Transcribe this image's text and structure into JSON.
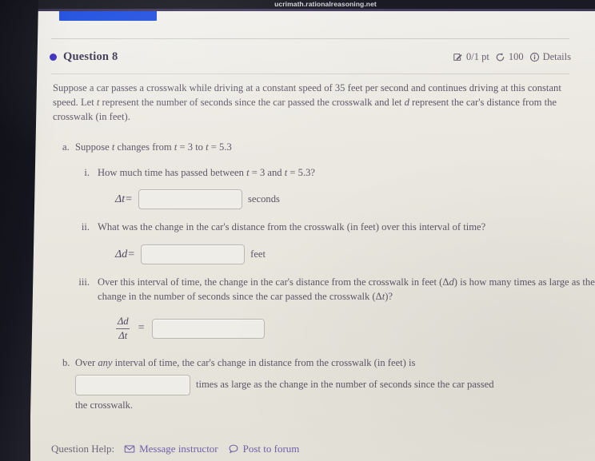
{
  "browser": {
    "url": "ucrimath.rationalreasoning.net"
  },
  "question_header": {
    "title": "Question 8",
    "points": "0/1 pt",
    "attempts": "100",
    "details_label": "Details",
    "bullet_color": "#3a2ec0",
    "points_icon": "checkbox-pencil-icon",
    "attempts_icon": "retry-arrow-icon",
    "details_icon": "info-circle-icon"
  },
  "prompt": {
    "text": "Suppose a car passes a crosswalk while driving at a constant speed of 35 feet per second and continues driving at this constant speed. Let t represent the number of seconds since the car passed the crosswalk and let d represent the car's distance from the crosswalk (in feet)."
  },
  "parts": {
    "a": {
      "marker": "a.",
      "text": "Suppose t changes from t = 3 to t = 5.3",
      "sub": [
        {
          "marker": "i.",
          "text": "How much time has passed between t = 3 and t = 5.3?",
          "answer_label_lhs": "Δt",
          "answer_label_op": "=",
          "answer_value": "",
          "answer_placeholder": "",
          "unit": "seconds"
        },
        {
          "marker": "ii.",
          "text": "What was the change in the car's distance from the crosswalk (in feet) over this interval of time?",
          "answer_label_lhs": "Δd",
          "answer_label_op": "=",
          "answer_value": "",
          "answer_placeholder": "",
          "unit": "feet"
        },
        {
          "marker": "iii.",
          "text": "Over this interval of time, the change in the car's distance from the crosswalk in feet (Δd) is how many times as large as the change in the number of seconds since the car passed the crosswalk (Δt)?",
          "fraction_numerator": "Δd",
          "fraction_denominator": "Δt",
          "answer_label_op": "=",
          "answer_value": "",
          "answer_placeholder": "",
          "unit": ""
        }
      ]
    },
    "b": {
      "marker": "b.",
      "text_before": "Over any interval of time, the car's change in distance from the crosswalk (in feet) is",
      "emphasis_word": "any",
      "answer_value": "",
      "answer_placeholder": "",
      "text_after": "times as large as the change in the number of seconds since the car passed",
      "text_end": "the crosswalk."
    }
  },
  "footer": {
    "help_label": "Question Help:",
    "message_instructor": "Message instructor",
    "message_icon": "envelope-icon",
    "post_forum": "Post to forum",
    "forum_icon": "speech-bubble-icon",
    "link_color": "#6f5fa8"
  }
}
